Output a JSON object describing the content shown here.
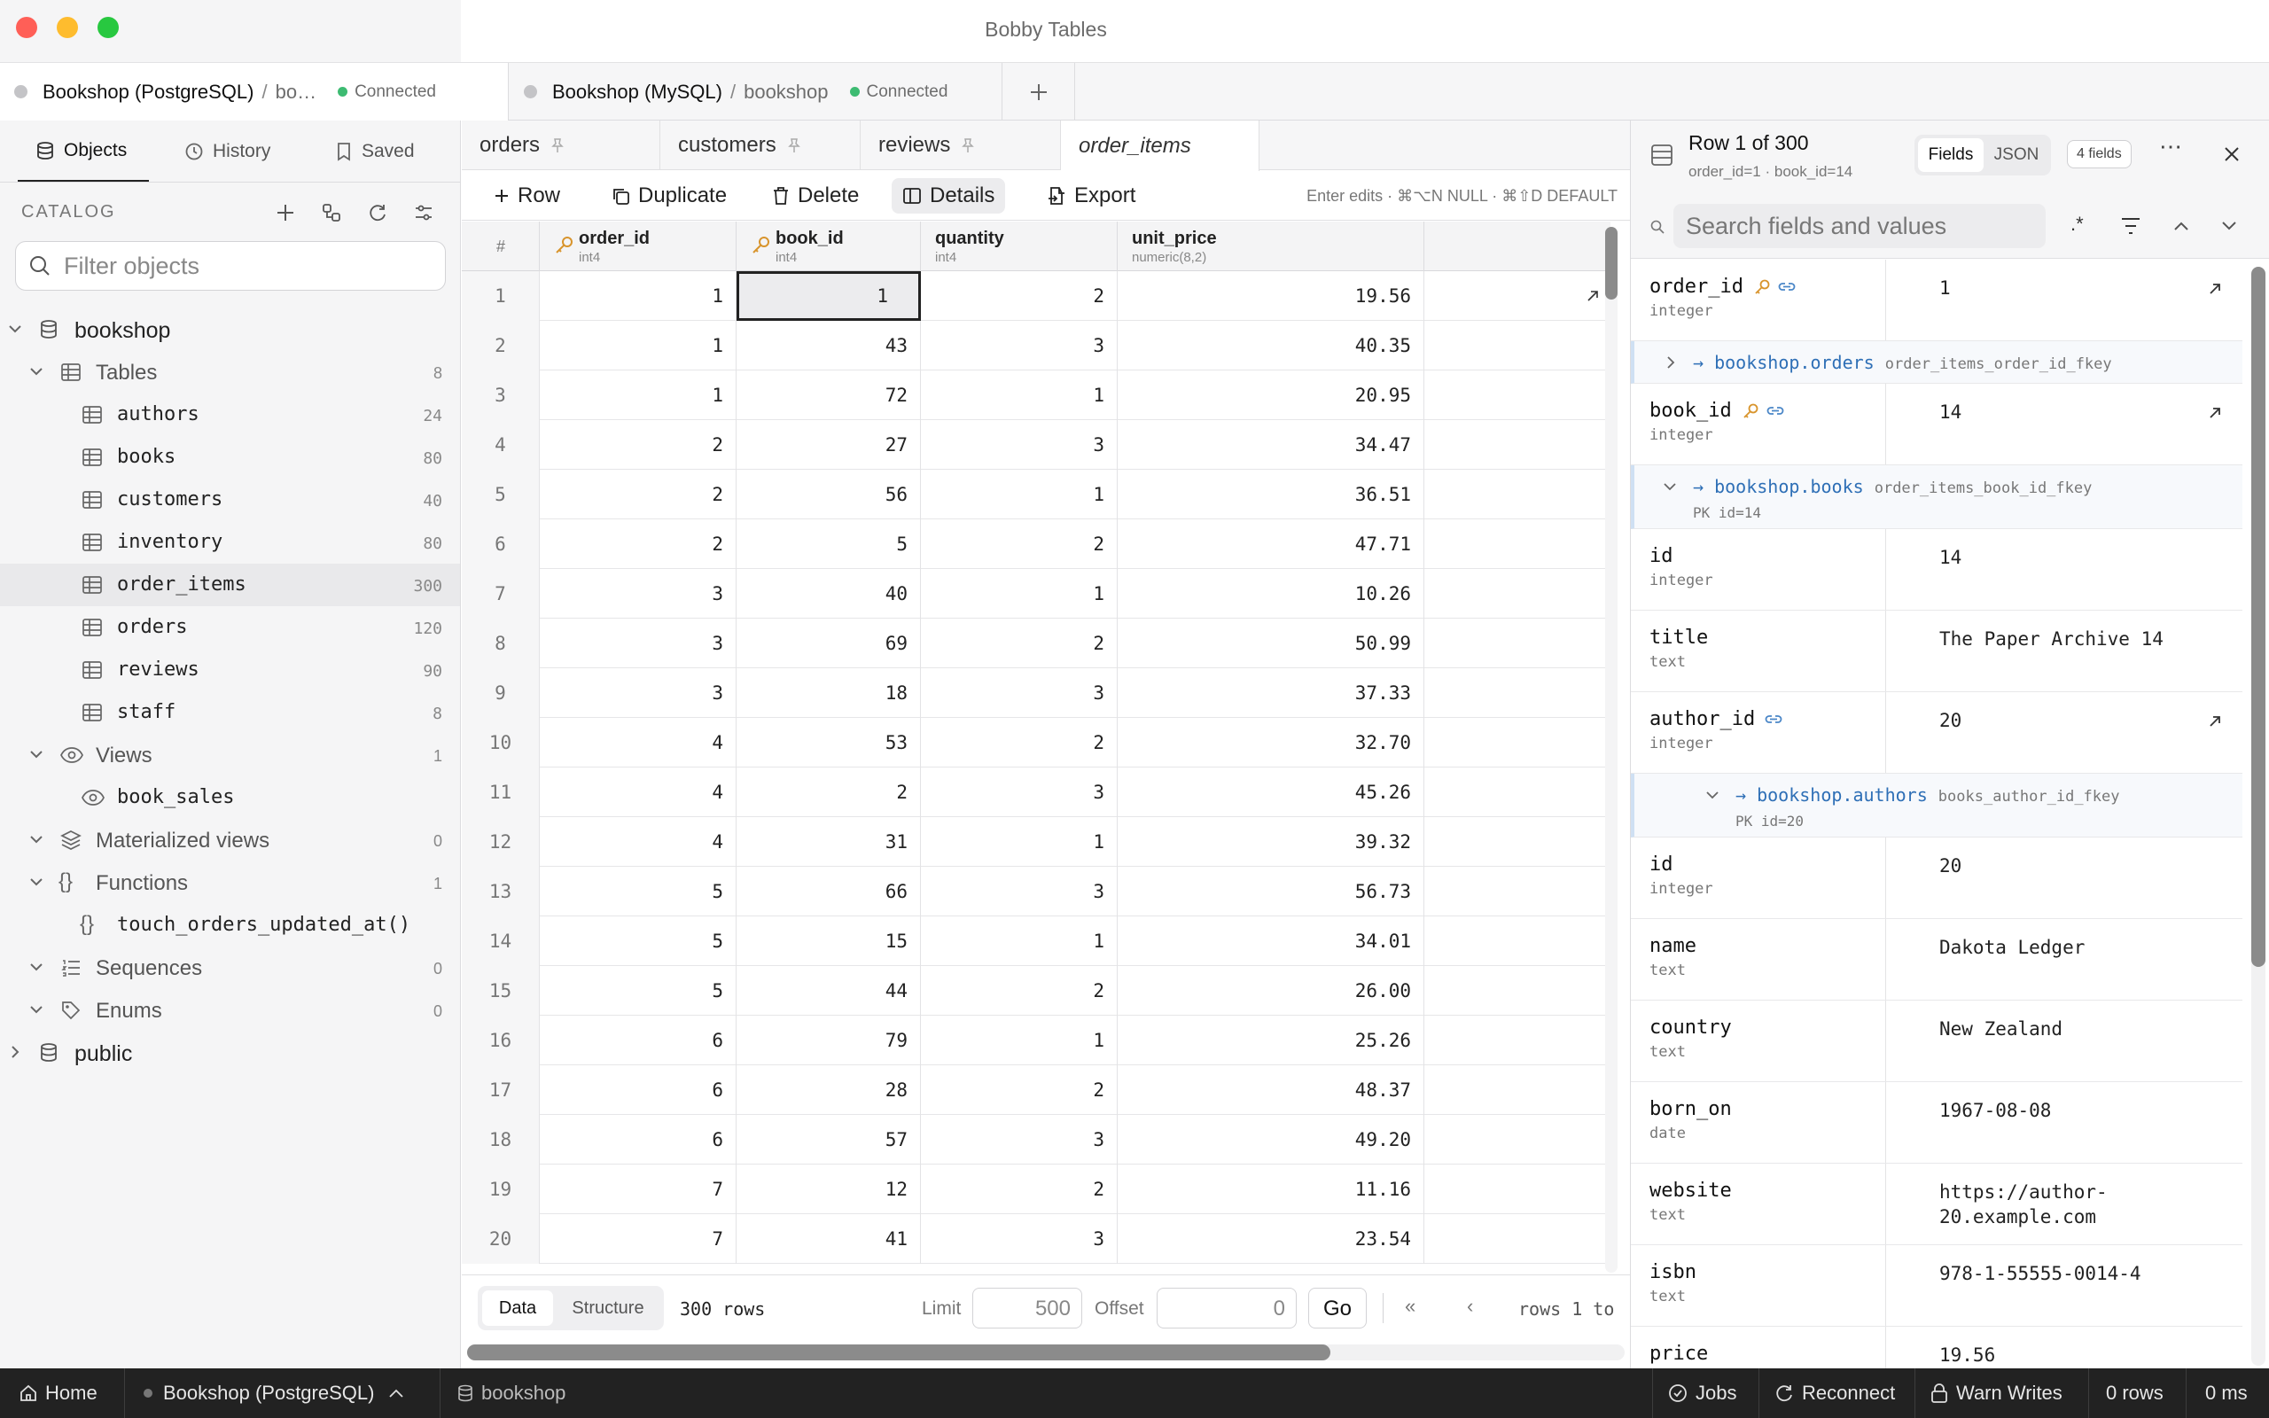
{
  "window": {
    "title": "Bobby Tables"
  },
  "connections": [
    {
      "name": "Bookshop (PostgreSQL)",
      "db": "bo…",
      "status": "Connected"
    },
    {
      "name": "Bookshop (MySQL)",
      "db": "bookshop",
      "status": "Connected"
    }
  ],
  "sidebar": {
    "tabs": [
      "Objects",
      "History",
      "Saved"
    ],
    "catalog_label": "CATALOG",
    "filter_placeholder": "Filter objects",
    "tree": {
      "db": "bookshop",
      "tables_label": "Tables",
      "tables_count": "8",
      "tables": [
        {
          "name": "authors",
          "count": "24"
        },
        {
          "name": "books",
          "count": "80"
        },
        {
          "name": "customers",
          "count": "40"
        },
        {
          "name": "inventory",
          "count": "80"
        },
        {
          "name": "order_items",
          "count": "300"
        },
        {
          "name": "orders",
          "count": "120"
        },
        {
          "name": "reviews",
          "count": "90"
        },
        {
          "name": "staff",
          "count": "8"
        }
      ],
      "views_label": "Views",
      "views_count": "1",
      "views": [
        "book_sales"
      ],
      "matviews_label": "Materialized views",
      "matviews_count": "0",
      "functions_label": "Functions",
      "functions_count": "1",
      "functions": [
        "touch_orders_updated_at()"
      ],
      "sequences_label": "Sequences",
      "sequences_count": "0",
      "enums_label": "Enums",
      "enums_count": "0",
      "schema2": "public"
    }
  },
  "query_tabs": [
    "orders",
    "customers",
    "reviews",
    "order_items"
  ],
  "toolbar": {
    "row": "Row",
    "duplicate": "Duplicate",
    "delete": "Delete",
    "details": "Details",
    "export": "Export",
    "hint": "Enter edits · ⌘⌥N NULL · ⌘⇧D DEFAULT"
  },
  "grid": {
    "columns": [
      {
        "name": "order_id",
        "type": "int4"
      },
      {
        "name": "book_id",
        "type": "int4"
      },
      {
        "name": "quantity",
        "type": "int4"
      },
      {
        "name": "unit_price",
        "type": "numeric(8,2)"
      }
    ],
    "rownum_header": "#",
    "rows": [
      [
        "1",
        "1",
        "1",
        "2",
        "19.56"
      ],
      [
        "2",
        "1",
        "43",
        "3",
        "40.35"
      ],
      [
        "3",
        "1",
        "72",
        "1",
        "20.95"
      ],
      [
        "4",
        "2",
        "27",
        "3",
        "34.47"
      ],
      [
        "5",
        "2",
        "56",
        "1",
        "36.51"
      ],
      [
        "6",
        "2",
        "5",
        "2",
        "47.71"
      ],
      [
        "7",
        "3",
        "40",
        "1",
        "10.26"
      ],
      [
        "8",
        "3",
        "69",
        "2",
        "50.99"
      ],
      [
        "9",
        "3",
        "18",
        "3",
        "37.33"
      ],
      [
        "10",
        "4",
        "53",
        "2",
        "32.70"
      ],
      [
        "11",
        "4",
        "2",
        "3",
        "45.26"
      ],
      [
        "12",
        "4",
        "31",
        "1",
        "39.32"
      ],
      [
        "13",
        "5",
        "66",
        "3",
        "56.73"
      ],
      [
        "14",
        "5",
        "15",
        "1",
        "34.01"
      ],
      [
        "15",
        "5",
        "44",
        "2",
        "26.00"
      ],
      [
        "16",
        "6",
        "79",
        "1",
        "25.26"
      ],
      [
        "17",
        "6",
        "28",
        "2",
        "48.37"
      ],
      [
        "18",
        "6",
        "57",
        "3",
        "49.20"
      ],
      [
        "19",
        "7",
        "12",
        "2",
        "11.16"
      ],
      [
        "20",
        "7",
        "41",
        "3",
        "23.54"
      ]
    ]
  },
  "footer": {
    "data_tab": "Data",
    "structure_tab": "Structure",
    "row_count": "300 rows",
    "limit_label": "Limit",
    "limit_value": "500",
    "offset_label": "Offset",
    "offset_value": "0",
    "go": "Go",
    "range": "rows 1 to"
  },
  "details": {
    "title": "Row 1 of 300",
    "subtitle": "order_id=1 · book_id=14",
    "fields_tab": "Fields",
    "json_tab": "JSON",
    "count_badge": "4 fields",
    "search_placeholder": "Search fields and values",
    "f1": {
      "name": "order_id",
      "type": "integer",
      "value": "1"
    },
    "fk1": {
      "target": "bookshop.orders",
      "constraint": "order_items_order_id_fkey"
    },
    "f2": {
      "name": "book_id",
      "type": "integer",
      "value": "14"
    },
    "fk2": {
      "target": "bookshop.books",
      "constraint": "order_items_book_id_fkey",
      "pk": "PK id=14"
    },
    "b1": {
      "name": "id",
      "type": "integer",
      "value": "14"
    },
    "b2": {
      "name": "title",
      "type": "text",
      "value": "The Paper Archive 14"
    },
    "b3": {
      "name": "author_id",
      "type": "integer",
      "value": "20"
    },
    "fk3": {
      "target": "bookshop.authors",
      "constraint": "books_author_id_fkey",
      "pk": "PK id=20"
    },
    "a1": {
      "name": "id",
      "type": "integer",
      "value": "20"
    },
    "a2": {
      "name": "name",
      "type": "text",
      "value": "Dakota Ledger"
    },
    "a3": {
      "name": "country",
      "type": "text",
      "value": "New Zealand"
    },
    "a4": {
      "name": "born_on",
      "type": "date",
      "value": "1967-08-08"
    },
    "a5": {
      "name": "website",
      "type": "text",
      "value": "https://author-20.example.com"
    },
    "b4": {
      "name": "isbn",
      "type": "text",
      "value": "978-1-55555-0014-4"
    },
    "b5": {
      "name": "price",
      "value": "19.56"
    }
  },
  "statusbar": {
    "home": "Home",
    "connection": "Bookshop (PostgreSQL)",
    "database": "bookshop",
    "jobs": "Jobs",
    "reconnect": "Reconnect",
    "warn": "Warn Writes",
    "rows": "0 rows",
    "time": "0 ms"
  }
}
